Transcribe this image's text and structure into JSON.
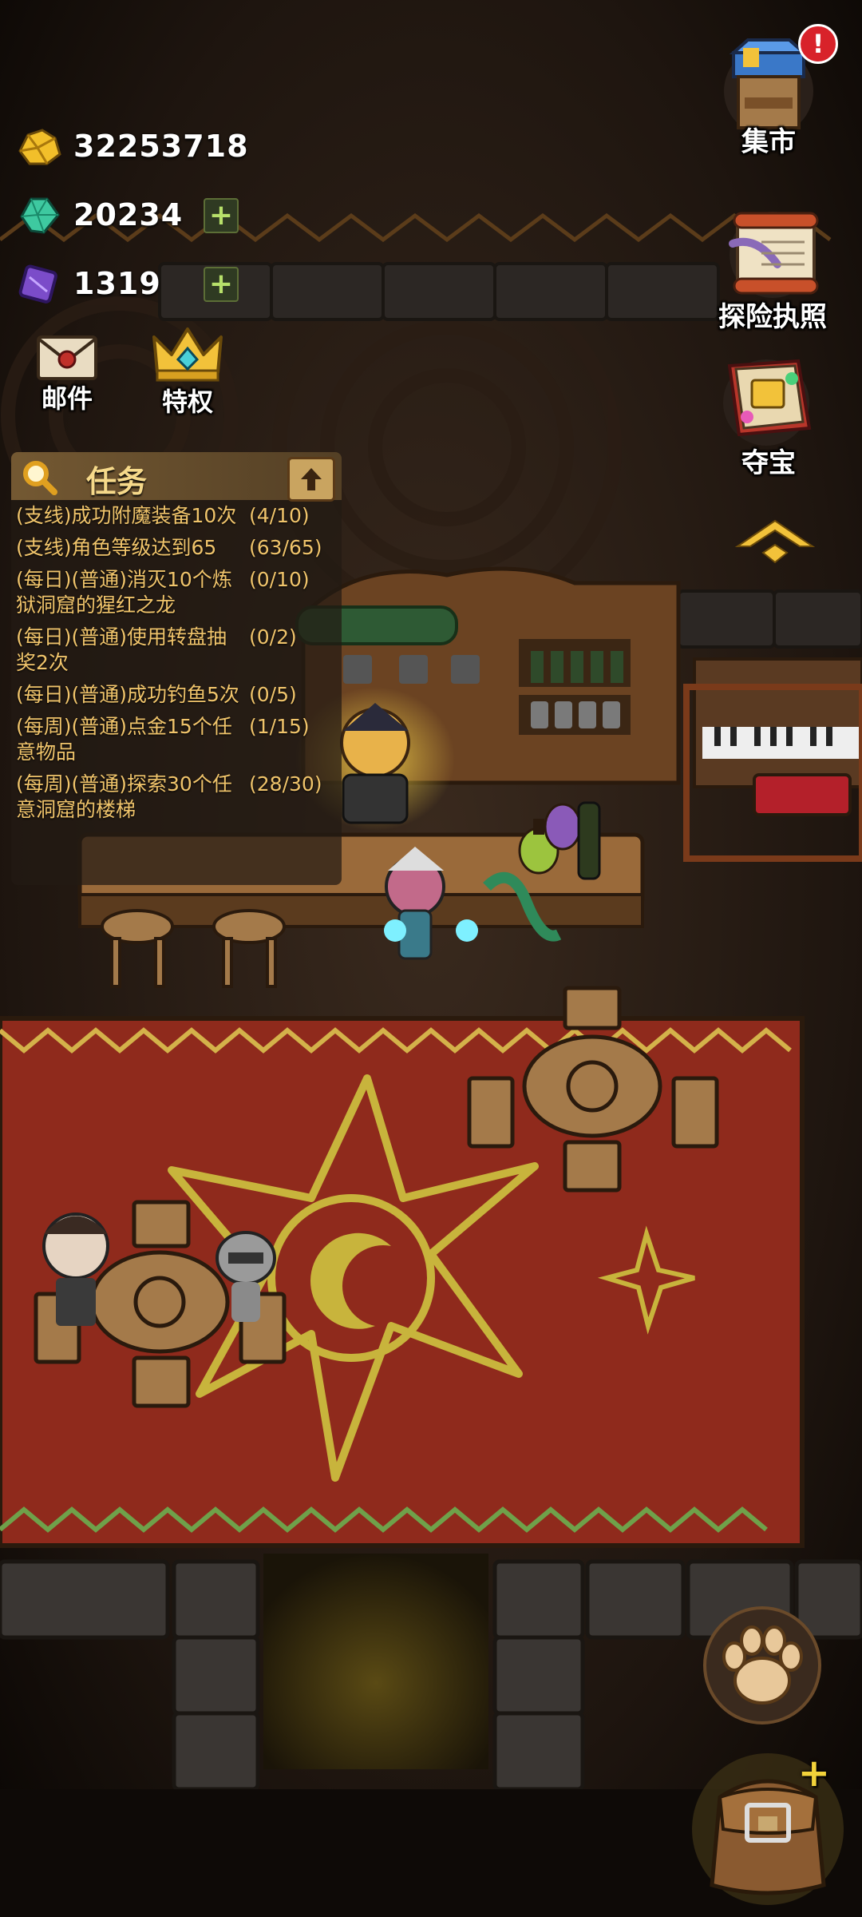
{
  "resources": {
    "gold": "32253718",
    "gems": "20234",
    "crystals": "1319"
  },
  "left_buttons": {
    "mail_label": "邮件",
    "privilege_label": "特权"
  },
  "right_buttons": {
    "market_label": "集市",
    "license_label": "探险执照",
    "treasure_label": "夺宝"
  },
  "tasks": {
    "title": "任务",
    "items": [
      {
        "text": "(支线)成功附魔装备10次",
        "progress": "(4/10)"
      },
      {
        "text": "(支线)角色等级达到65",
        "progress": "(63/65)"
      },
      {
        "text": "(每日)(普通)消灭10个炼狱洞窟的猩红之龙",
        "progress": "(0/10)"
      },
      {
        "text": "(每日)(普通)使用转盘抽奖2次",
        "progress": "(0/2)"
      },
      {
        "text": "(每日)(普通)成功钓鱼5次",
        "progress": "(0/5)"
      },
      {
        "text": "(每周)(普通)点金15个任意物品",
        "progress": "(1/15)"
      },
      {
        "text": "(每周)(普通)探索30个任意洞窟的楼梯",
        "progress": "(28/30)"
      }
    ]
  },
  "icons": {
    "gold": "gold-ore-icon",
    "gem": "green-gem-icon",
    "crystal": "purple-crystal-icon",
    "mail": "mail-envelope-icon",
    "crown": "crown-icon",
    "search": "magnifier-icon",
    "collapse": "arrow-up-icon",
    "market": "market-stall-icon",
    "license": "scroll-quill-icon",
    "treasure": "treasure-book-icon",
    "expand": "chevron-up-icon",
    "paw": "paw-icon",
    "bag": "backpack-icon",
    "alert": "exclamation-icon"
  },
  "colors": {
    "task_text": "#f0c46b",
    "carpet": "#8f2a1c",
    "carpet_pattern": "#c8b43c",
    "alert_red": "#d8222a"
  }
}
